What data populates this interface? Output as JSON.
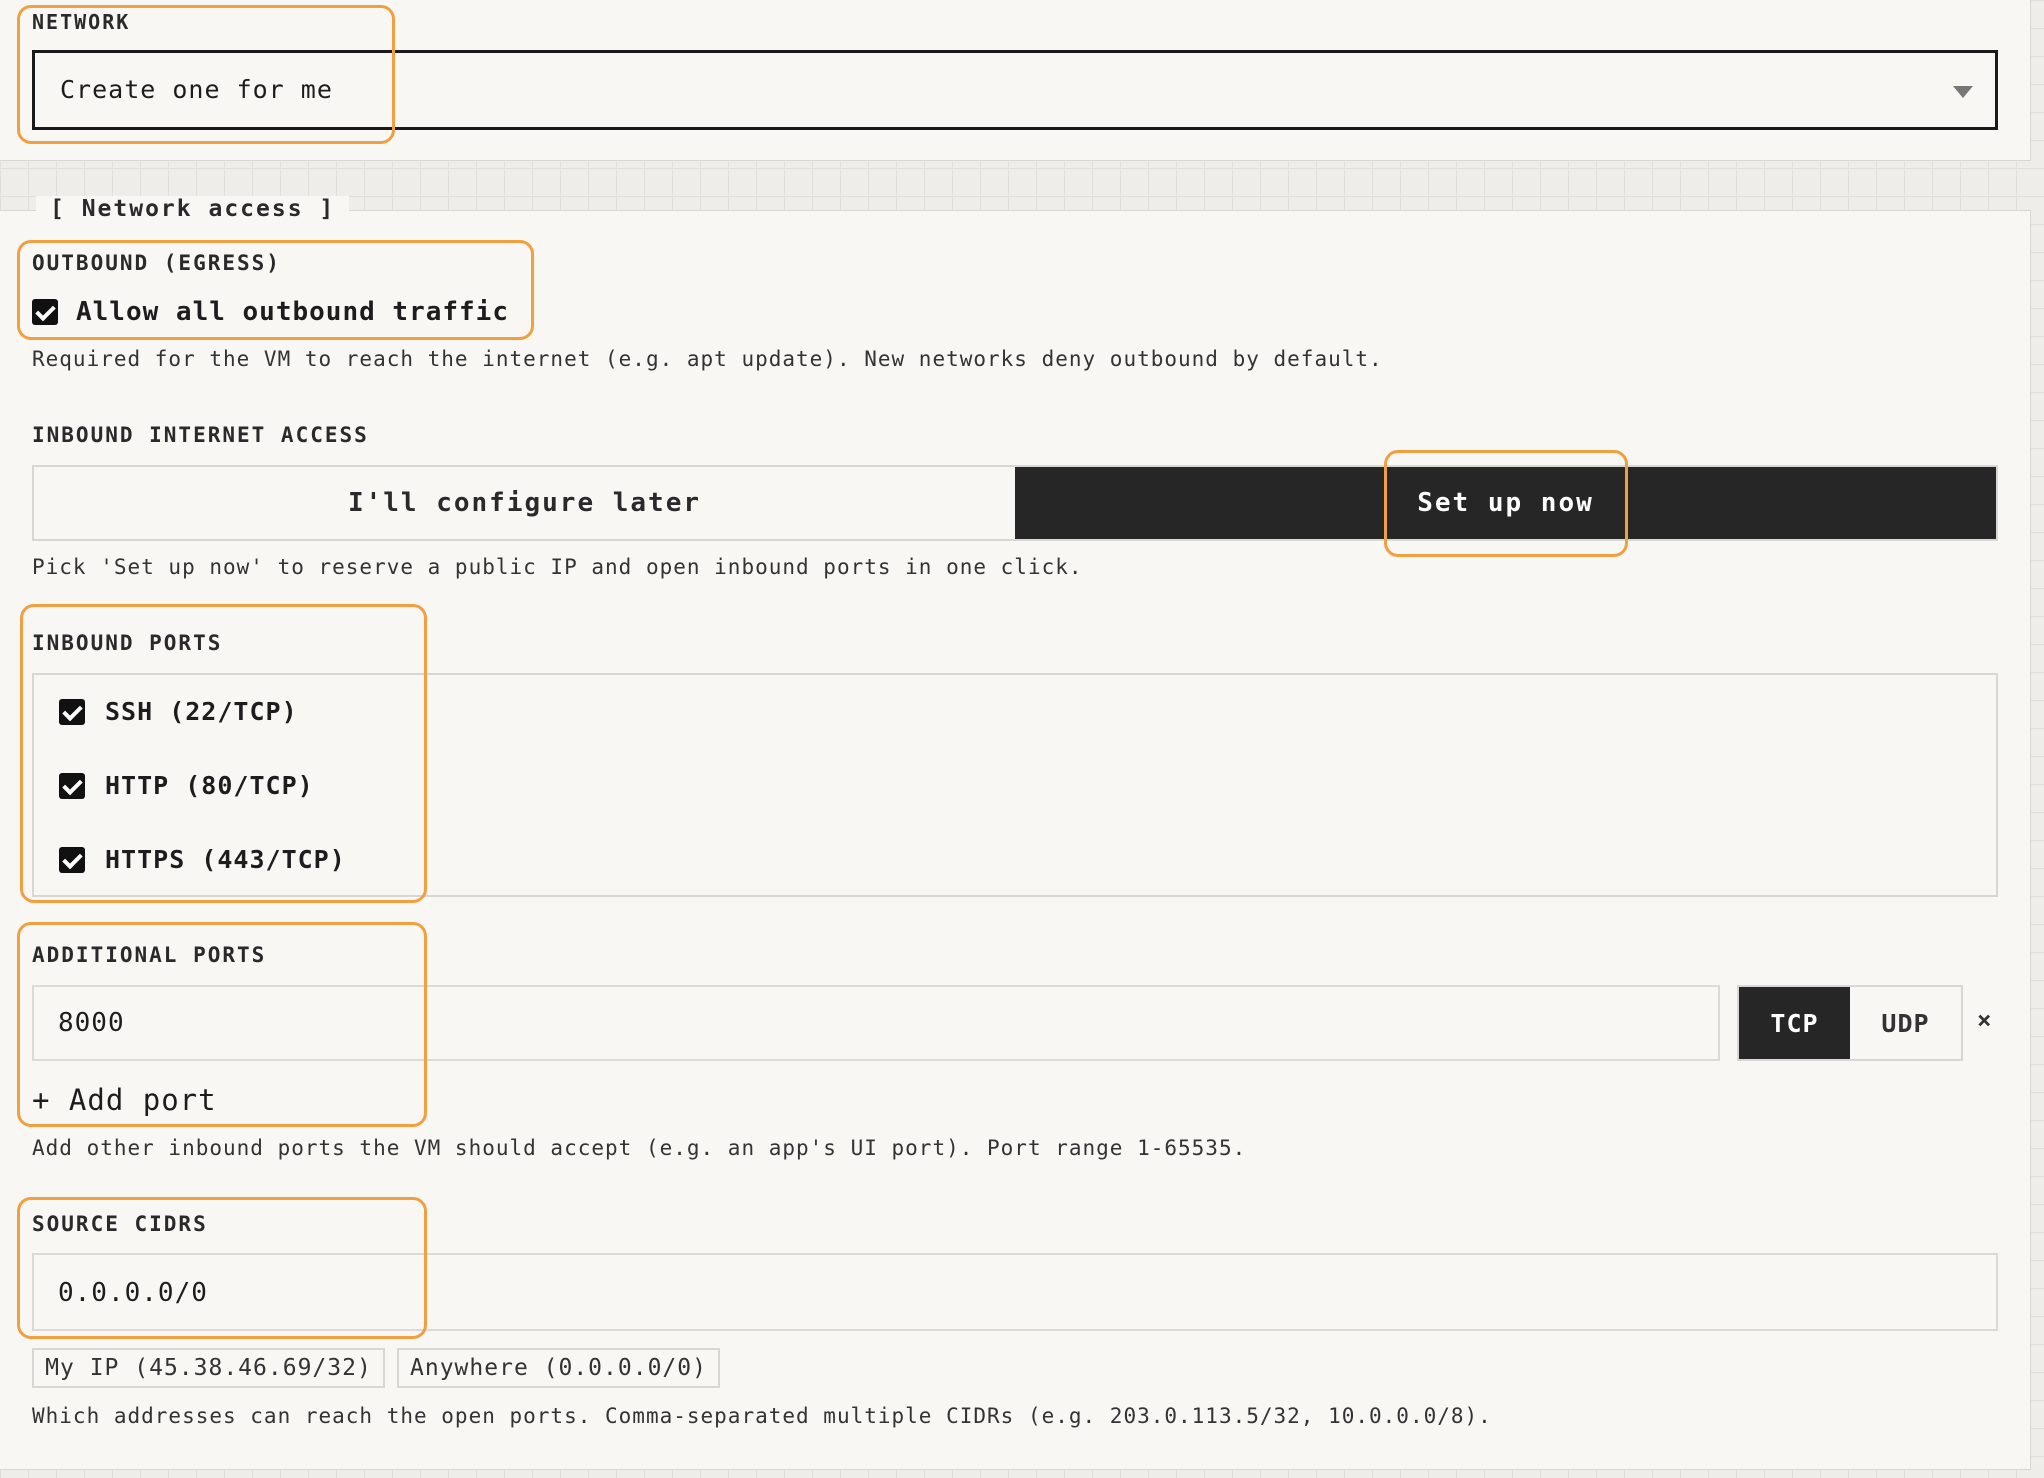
{
  "network": {
    "label": "NETWORK",
    "selected": "Create one for me",
    "chevron_icon": "chevron-down-icon"
  },
  "network_access": {
    "legend": "[ Network access ]",
    "outbound": {
      "label": "OUTBOUND (EGRESS)",
      "checkbox_label": "Allow all outbound traffic",
      "checked": true,
      "help": "Required for the VM to reach the internet (e.g. apt update). New networks deny outbound by default."
    },
    "inbound_access": {
      "label": "INBOUND INTERNET ACCESS",
      "options": [
        "I'll configure later",
        "Set up now"
      ],
      "selected": "Set up now",
      "help": "Pick 'Set up now' to reserve a public IP and open inbound ports in one click."
    },
    "inbound_ports": {
      "label": "INBOUND PORTS",
      "items": [
        {
          "label": "SSH (22/TCP)",
          "checked": true
        },
        {
          "label": "HTTP (80/TCP)",
          "checked": true
        },
        {
          "label": "HTTPS (443/TCP)",
          "checked": true
        }
      ]
    },
    "additional_ports": {
      "label": "ADDITIONAL PORTS",
      "port_value": "8000",
      "protocols": [
        "TCP",
        "UDP"
      ],
      "selected_protocol": "TCP",
      "remove_label": "×",
      "add_label": "+ Add port",
      "help": "Add other inbound ports the VM should accept (e.g. an app's UI port). Port range 1-65535."
    },
    "source_cidrs": {
      "label": "SOURCE CIDRS",
      "value": "0.0.0.0/0",
      "quick_picks": [
        "My IP (45.38.46.69/32)",
        "Anywhere (0.0.0.0/0)"
      ],
      "help": "Which addresses can reach the open ports. Comma-separated multiple CIDRs (e.g. 203.0.113.5/32, 10.0.0.0/8)."
    }
  },
  "colors": {
    "highlight": "#f0a040",
    "selected_bg": "#262626",
    "panel_bg": "#f8f7f4"
  }
}
